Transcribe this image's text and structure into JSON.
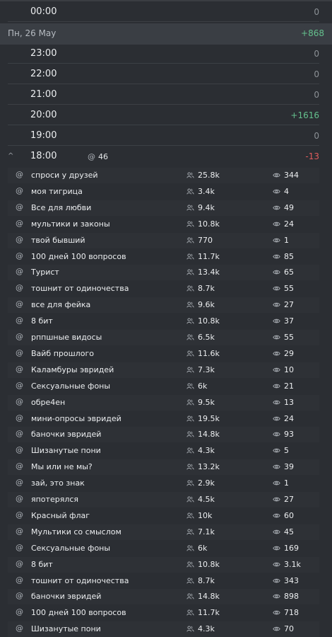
{
  "hours_top": [
    {
      "time": "00:00",
      "value": "0"
    }
  ],
  "day": {
    "date": "Пн, 26 May",
    "value": "+868"
  },
  "hours": [
    {
      "time": "23:00",
      "value": "0"
    },
    {
      "time": "22:00",
      "value": "0"
    },
    {
      "time": "21:00",
      "value": "0"
    },
    {
      "time": "20:00",
      "value": "+1616"
    },
    {
      "time": "19:00",
      "value": "0"
    }
  ],
  "expanded_hour": {
    "time": "18:00",
    "mentions": "46",
    "value": "-13",
    "chevron": "^"
  },
  "channels": [
    {
      "name": "спроси у друзей",
      "subs": "25.8k",
      "views": "344"
    },
    {
      "name": "моя тигрица",
      "subs": "3.4k",
      "views": "4"
    },
    {
      "name": "Все для любви",
      "subs": "9.4k",
      "views": "49"
    },
    {
      "name": "мультики и законы",
      "subs": "10.8k",
      "views": "24"
    },
    {
      "name": "твой бывший",
      "subs": "770",
      "views": "1"
    },
    {
      "name": "100 дней 100 вопросов",
      "subs": "11.7k",
      "views": "85"
    },
    {
      "name": "Турист",
      "subs": "13.4k",
      "views": "65"
    },
    {
      "name": "тошнит от одиночества",
      "subs": "8.7k",
      "views": "55"
    },
    {
      "name": "все для фейка",
      "subs": "9.6k",
      "views": "27"
    },
    {
      "name": "8 бит",
      "subs": "10.8k",
      "views": "37"
    },
    {
      "name": "рппшные видосы",
      "subs": "6.5k",
      "views": "55"
    },
    {
      "name": "Вайб прошлого",
      "subs": "11.6k",
      "views": "29"
    },
    {
      "name": "Каламбуры эвридей",
      "subs": "7.3k",
      "views": "10"
    },
    {
      "name": "Сексуальные фоны",
      "subs": "6k",
      "views": "21"
    },
    {
      "name": "обре4ен",
      "subs": "9.5k",
      "views": "13"
    },
    {
      "name": "мини-опросы эвридей",
      "subs": "19.5k",
      "views": "24"
    },
    {
      "name": "баночки эвридей",
      "subs": "14.8k",
      "views": "93"
    },
    {
      "name": "Шизанутые пони",
      "subs": "4.3k",
      "views": "5"
    },
    {
      "name": "Мы или не мы?",
      "subs": "13.2k",
      "views": "39"
    },
    {
      "name": "зай, это знак",
      "subs": "2.9k",
      "views": "1"
    },
    {
      "name": "япотерялся",
      "subs": "4.5k",
      "views": "27"
    },
    {
      "name": "Красный флаг",
      "subs": "10k",
      "views": "60"
    },
    {
      "name": "Мультики со смыслом",
      "subs": "7.1k",
      "views": "45"
    },
    {
      "name": "Сексуальные фоны",
      "subs": "6k",
      "views": "169"
    },
    {
      "name": "8 бит",
      "subs": "10.8k",
      "views": "3.1k"
    },
    {
      "name": "тошнит от одиночества",
      "subs": "8.7k",
      "views": "343"
    },
    {
      "name": "баночки эвридей",
      "subs": "14.8k",
      "views": "898"
    },
    {
      "name": "100 дней 100 вопросов",
      "subs": "11.7k",
      "views": "718"
    },
    {
      "name": "Шизанутые пони",
      "subs": "4.3k",
      "views": "70"
    }
  ],
  "at_symbol": "@",
  "icons": {
    "subscribers": "users-icon",
    "views": "eye-icon",
    "mention": "at-icon",
    "expand": "chevron-up-icon"
  },
  "colors": {
    "positive": "#64c08d",
    "negative": "#e05c5c",
    "zero": "#8c9196",
    "background": "#2b2e33"
  }
}
